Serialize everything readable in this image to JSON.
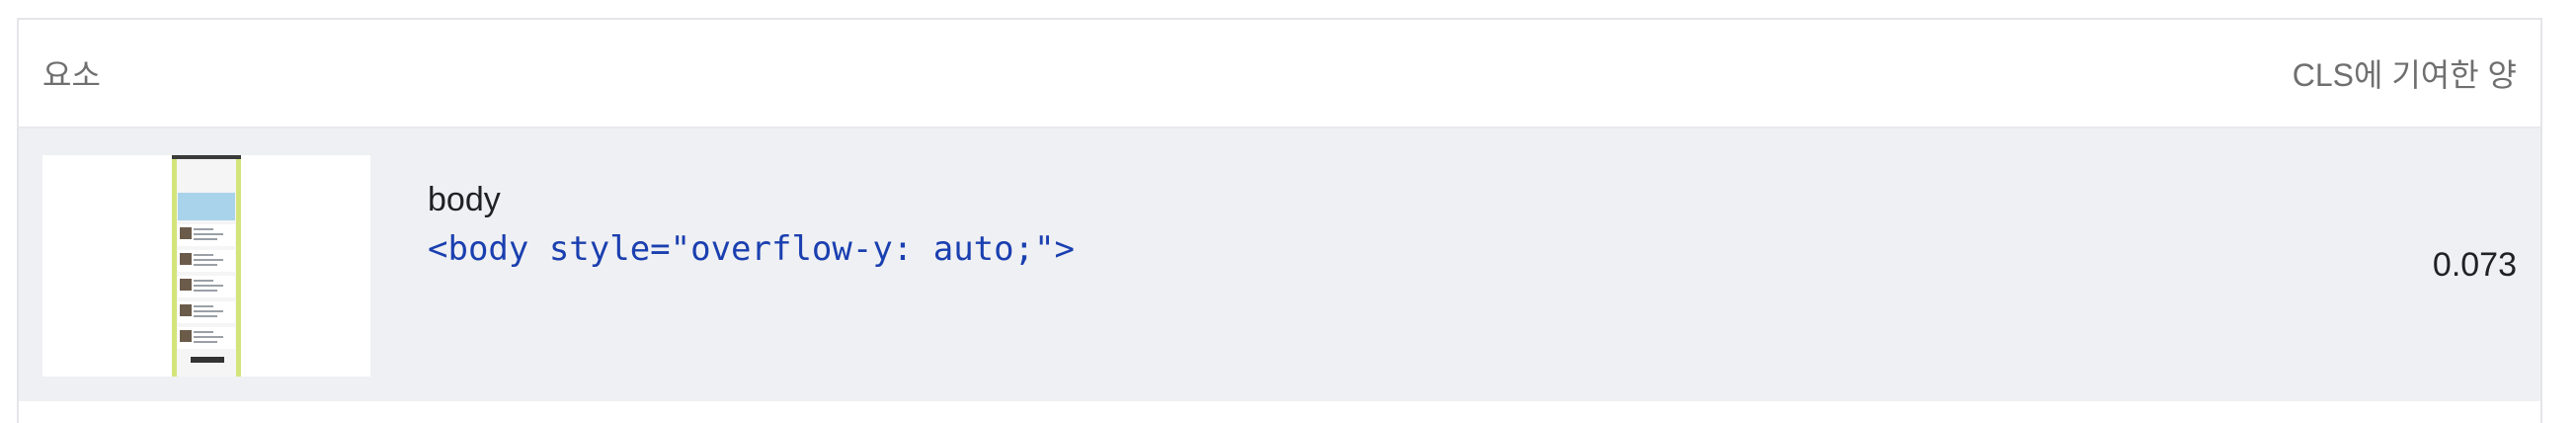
{
  "table": {
    "header": {
      "element_label": "요소",
      "cls_label": "CLS에 기여한 양"
    },
    "rows": [
      {
        "name": "body",
        "snippet": "<body style=\"overflow-y: auto;\">",
        "value": "0.073"
      }
    ]
  },
  "colors": {
    "row_background": "#eff0f3",
    "snippet_text": "#1a3fb0",
    "header_text": "#6f6f6f",
    "thumbnail_accent": "#d3e57a"
  }
}
